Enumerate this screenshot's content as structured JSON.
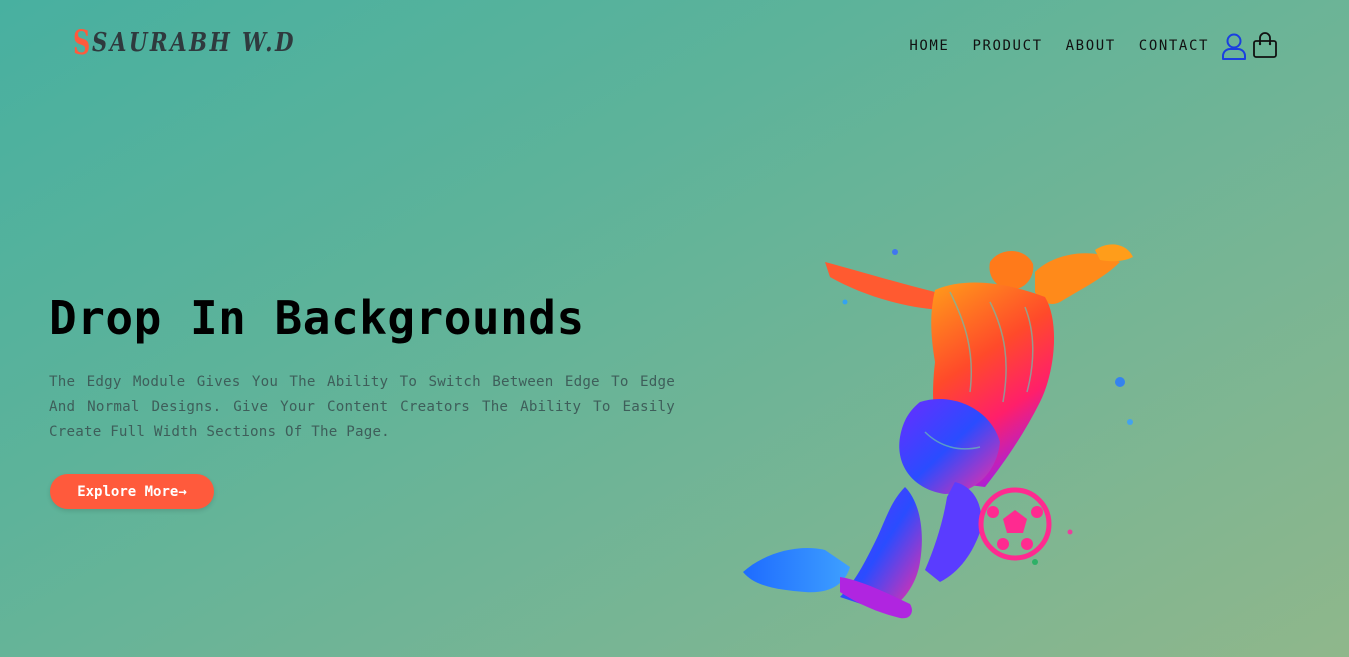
{
  "brand": {
    "mark": "S",
    "name": "SAURABH W.D"
  },
  "nav": {
    "items": [
      "HOME",
      "PRODUCT",
      "ABOUT",
      "CONTACT"
    ]
  },
  "icons": {
    "user": "user-icon",
    "cart": "shopping-bag-icon"
  },
  "hero": {
    "title": "Drop In Backgrounds",
    "description": "The Edgy Module Gives You The Ability To Switch Between Edge To Edge And Normal Designs. Give Your Content Creators The Ability To Easily Create Full Width Sections Of The Page.",
    "cta_label": "Explore More→"
  },
  "colors": {
    "accent": "#ff5a3c",
    "user_icon": "#1a3fe0",
    "bg_start": "#48b0a0",
    "bg_end": "#8fb78b"
  }
}
